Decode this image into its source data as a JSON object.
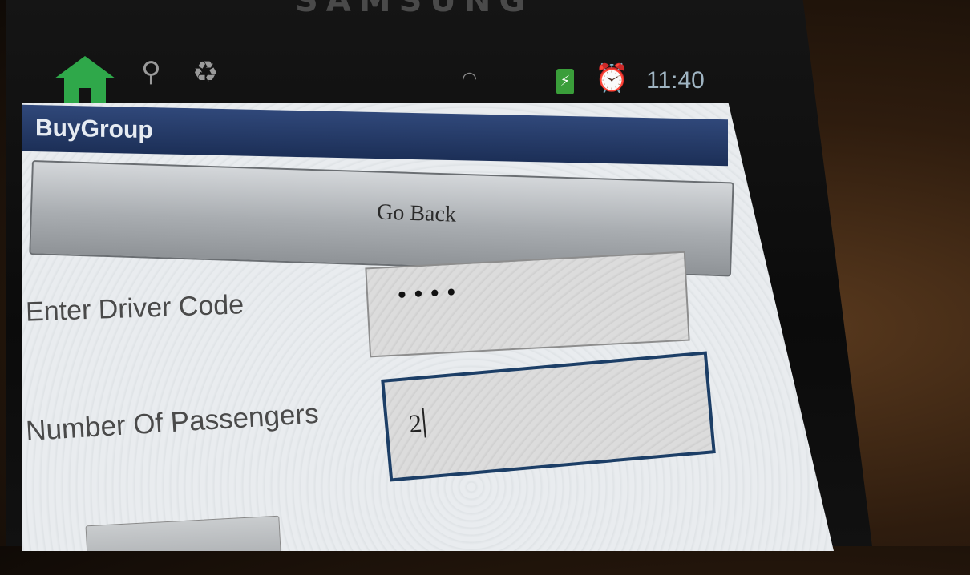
{
  "device": {
    "brand": "SAMSUNG"
  },
  "status_bar": {
    "icons": [
      "home-icon",
      "usb-icon",
      "recycle-icon",
      "wifi-icon",
      "battery-charging-icon",
      "alarm-icon"
    ],
    "time": "11:40"
  },
  "app": {
    "title": "BuyGroup",
    "go_back_label": "Go Back",
    "form": {
      "driver_code_label": "Enter Driver Code",
      "driver_code_value": "••••",
      "passengers_label": "Number Of Passengers",
      "passengers_value": "2"
    }
  },
  "colors": {
    "titlebar": "#1c2f57",
    "focus_border": "#1c3e66",
    "home_icon": "#2fa84a"
  }
}
